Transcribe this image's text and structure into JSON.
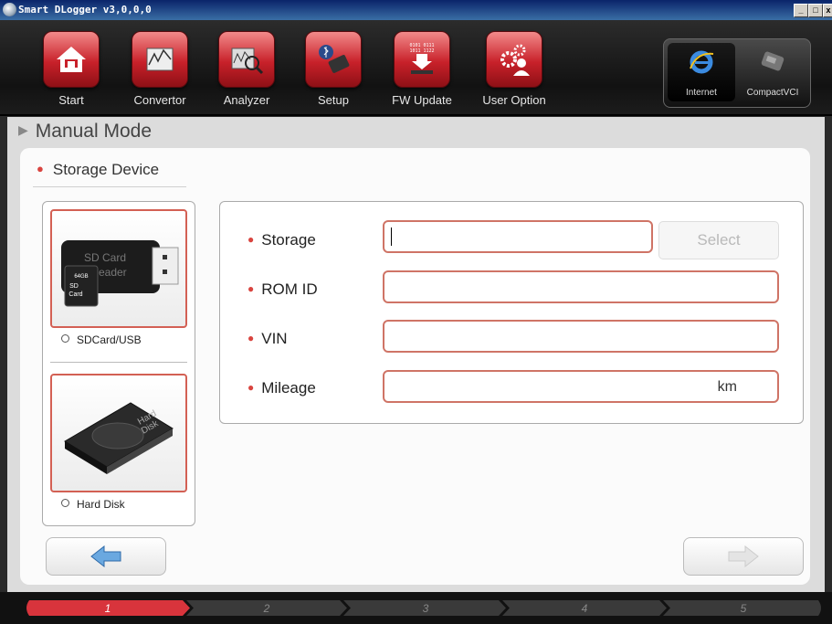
{
  "window": {
    "title": "Smart DLogger v3,0,0,0"
  },
  "toolbar": {
    "items": [
      {
        "label": "Start",
        "icon": "home-icon"
      },
      {
        "label": "Convertor",
        "icon": "convertor-icon"
      },
      {
        "label": "Analyzer",
        "icon": "analyzer-icon"
      },
      {
        "label": "Setup",
        "icon": "setup-icon"
      },
      {
        "label": "FW Update",
        "icon": "fw-update-icon"
      },
      {
        "label": "User Option",
        "icon": "user-option-icon"
      }
    ],
    "right": [
      {
        "label": "Internet",
        "icon": "internet-explorer-icon",
        "active": true
      },
      {
        "label": "CompactVCI",
        "icon": "compactvci-icon",
        "active": false
      }
    ],
    "fw_icon_text": [
      "0101 0111",
      "1011 1122"
    ]
  },
  "page": {
    "mode_title": "Manual Mode",
    "section_title": "Storage Device"
  },
  "devices": [
    {
      "label": "SDCard/USB",
      "selected": false,
      "card_text": [
        "SD Card",
        "Reader",
        "64GB",
        "SD",
        "Card"
      ]
    },
    {
      "label": "Hard Disk",
      "selected": false,
      "card_text": [
        "Hard",
        "Disk"
      ]
    }
  ],
  "form": {
    "storage_label": "Storage",
    "storage_value": "",
    "select_label": "Select",
    "rom_id_label": "ROM ID",
    "rom_id_value": "",
    "vin_label": "VIN",
    "vin_value": "",
    "mileage_label": "Mileage",
    "mileage_value": "",
    "mileage_unit": "km"
  },
  "steps": [
    {
      "label": "1",
      "active": true
    },
    {
      "label": "2",
      "active": false
    },
    {
      "label": "3",
      "active": false
    },
    {
      "label": "4",
      "active": false
    },
    {
      "label": "5",
      "active": false
    }
  ],
  "colors": {
    "accent": "#d9443f",
    "active_step": "#d8343c"
  }
}
